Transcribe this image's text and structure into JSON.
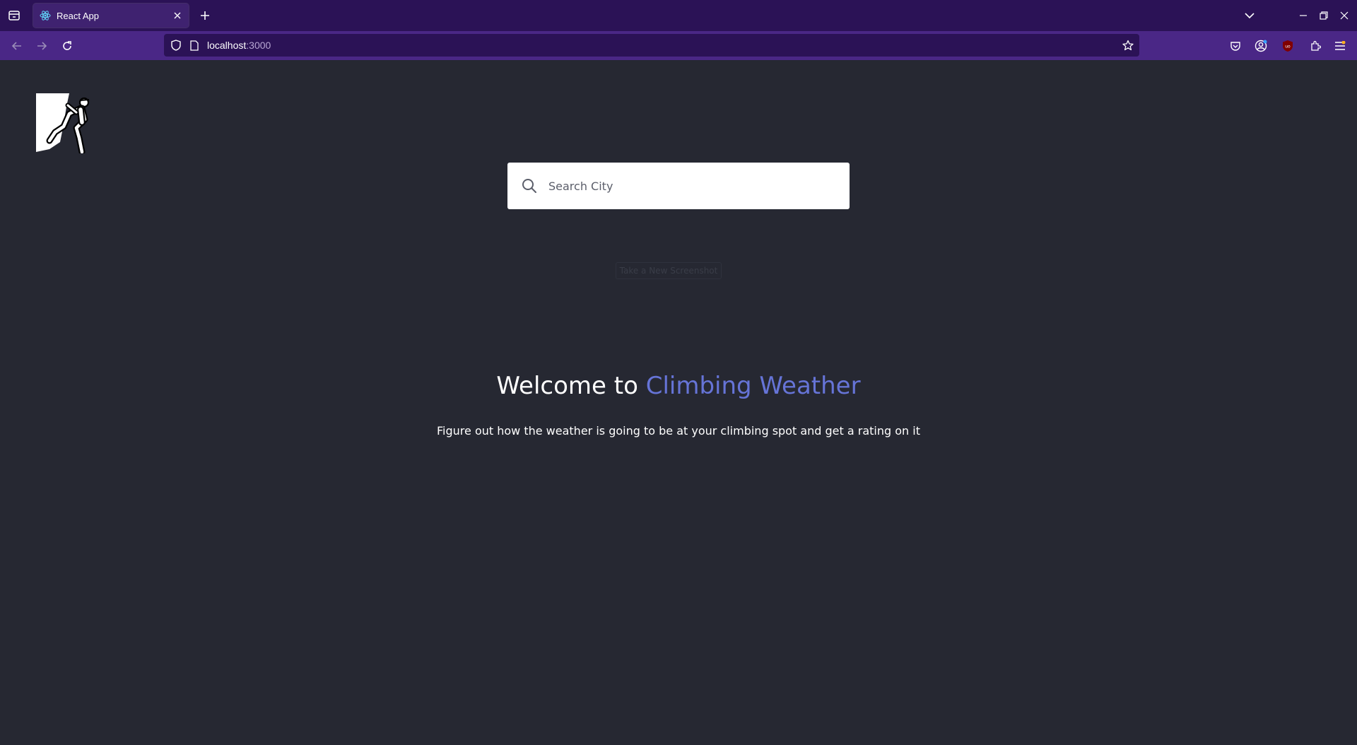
{
  "browser": {
    "tab": {
      "title": "React App",
      "favicon": "react-atom-icon"
    },
    "url": {
      "host": "localhost",
      "port": ":3000"
    },
    "icons": {
      "tab_list": "firefox-view-icon",
      "close_tab": "close-icon",
      "new_tab": "plus-icon",
      "list_all_tabs": "chevron-down-icon",
      "back": "back-arrow-icon",
      "forward": "forward-arrow-icon",
      "reload": "reload-icon",
      "tracking_protection": "shield-icon",
      "page_info": "page-icon",
      "bookmark": "star-icon",
      "pocket": "pocket-icon",
      "account": "account-icon",
      "ublock": "ublock-icon",
      "extensions": "puzzle-icon",
      "menu": "hamburger-icon",
      "minimize": "minimize-icon",
      "restore": "restore-icon",
      "close_window": "close-icon"
    },
    "colors": {
      "tabbar": "#2b1256",
      "navbar": "#4a2786",
      "urlbar": "#2b1256"
    }
  },
  "page": {
    "logo": "climber-logo",
    "search": {
      "placeholder": "Search City",
      "value": ""
    },
    "screenshot_button": "Take a New Screenshot",
    "welcome": {
      "prefix": "Welcome to ",
      "accent": "Climbing Weather"
    },
    "subtitle": "Figure out how the weather is going to be at your climbing spot and get a rating on it",
    "colors": {
      "background": "#262832",
      "accent": "#6674d7"
    }
  }
}
